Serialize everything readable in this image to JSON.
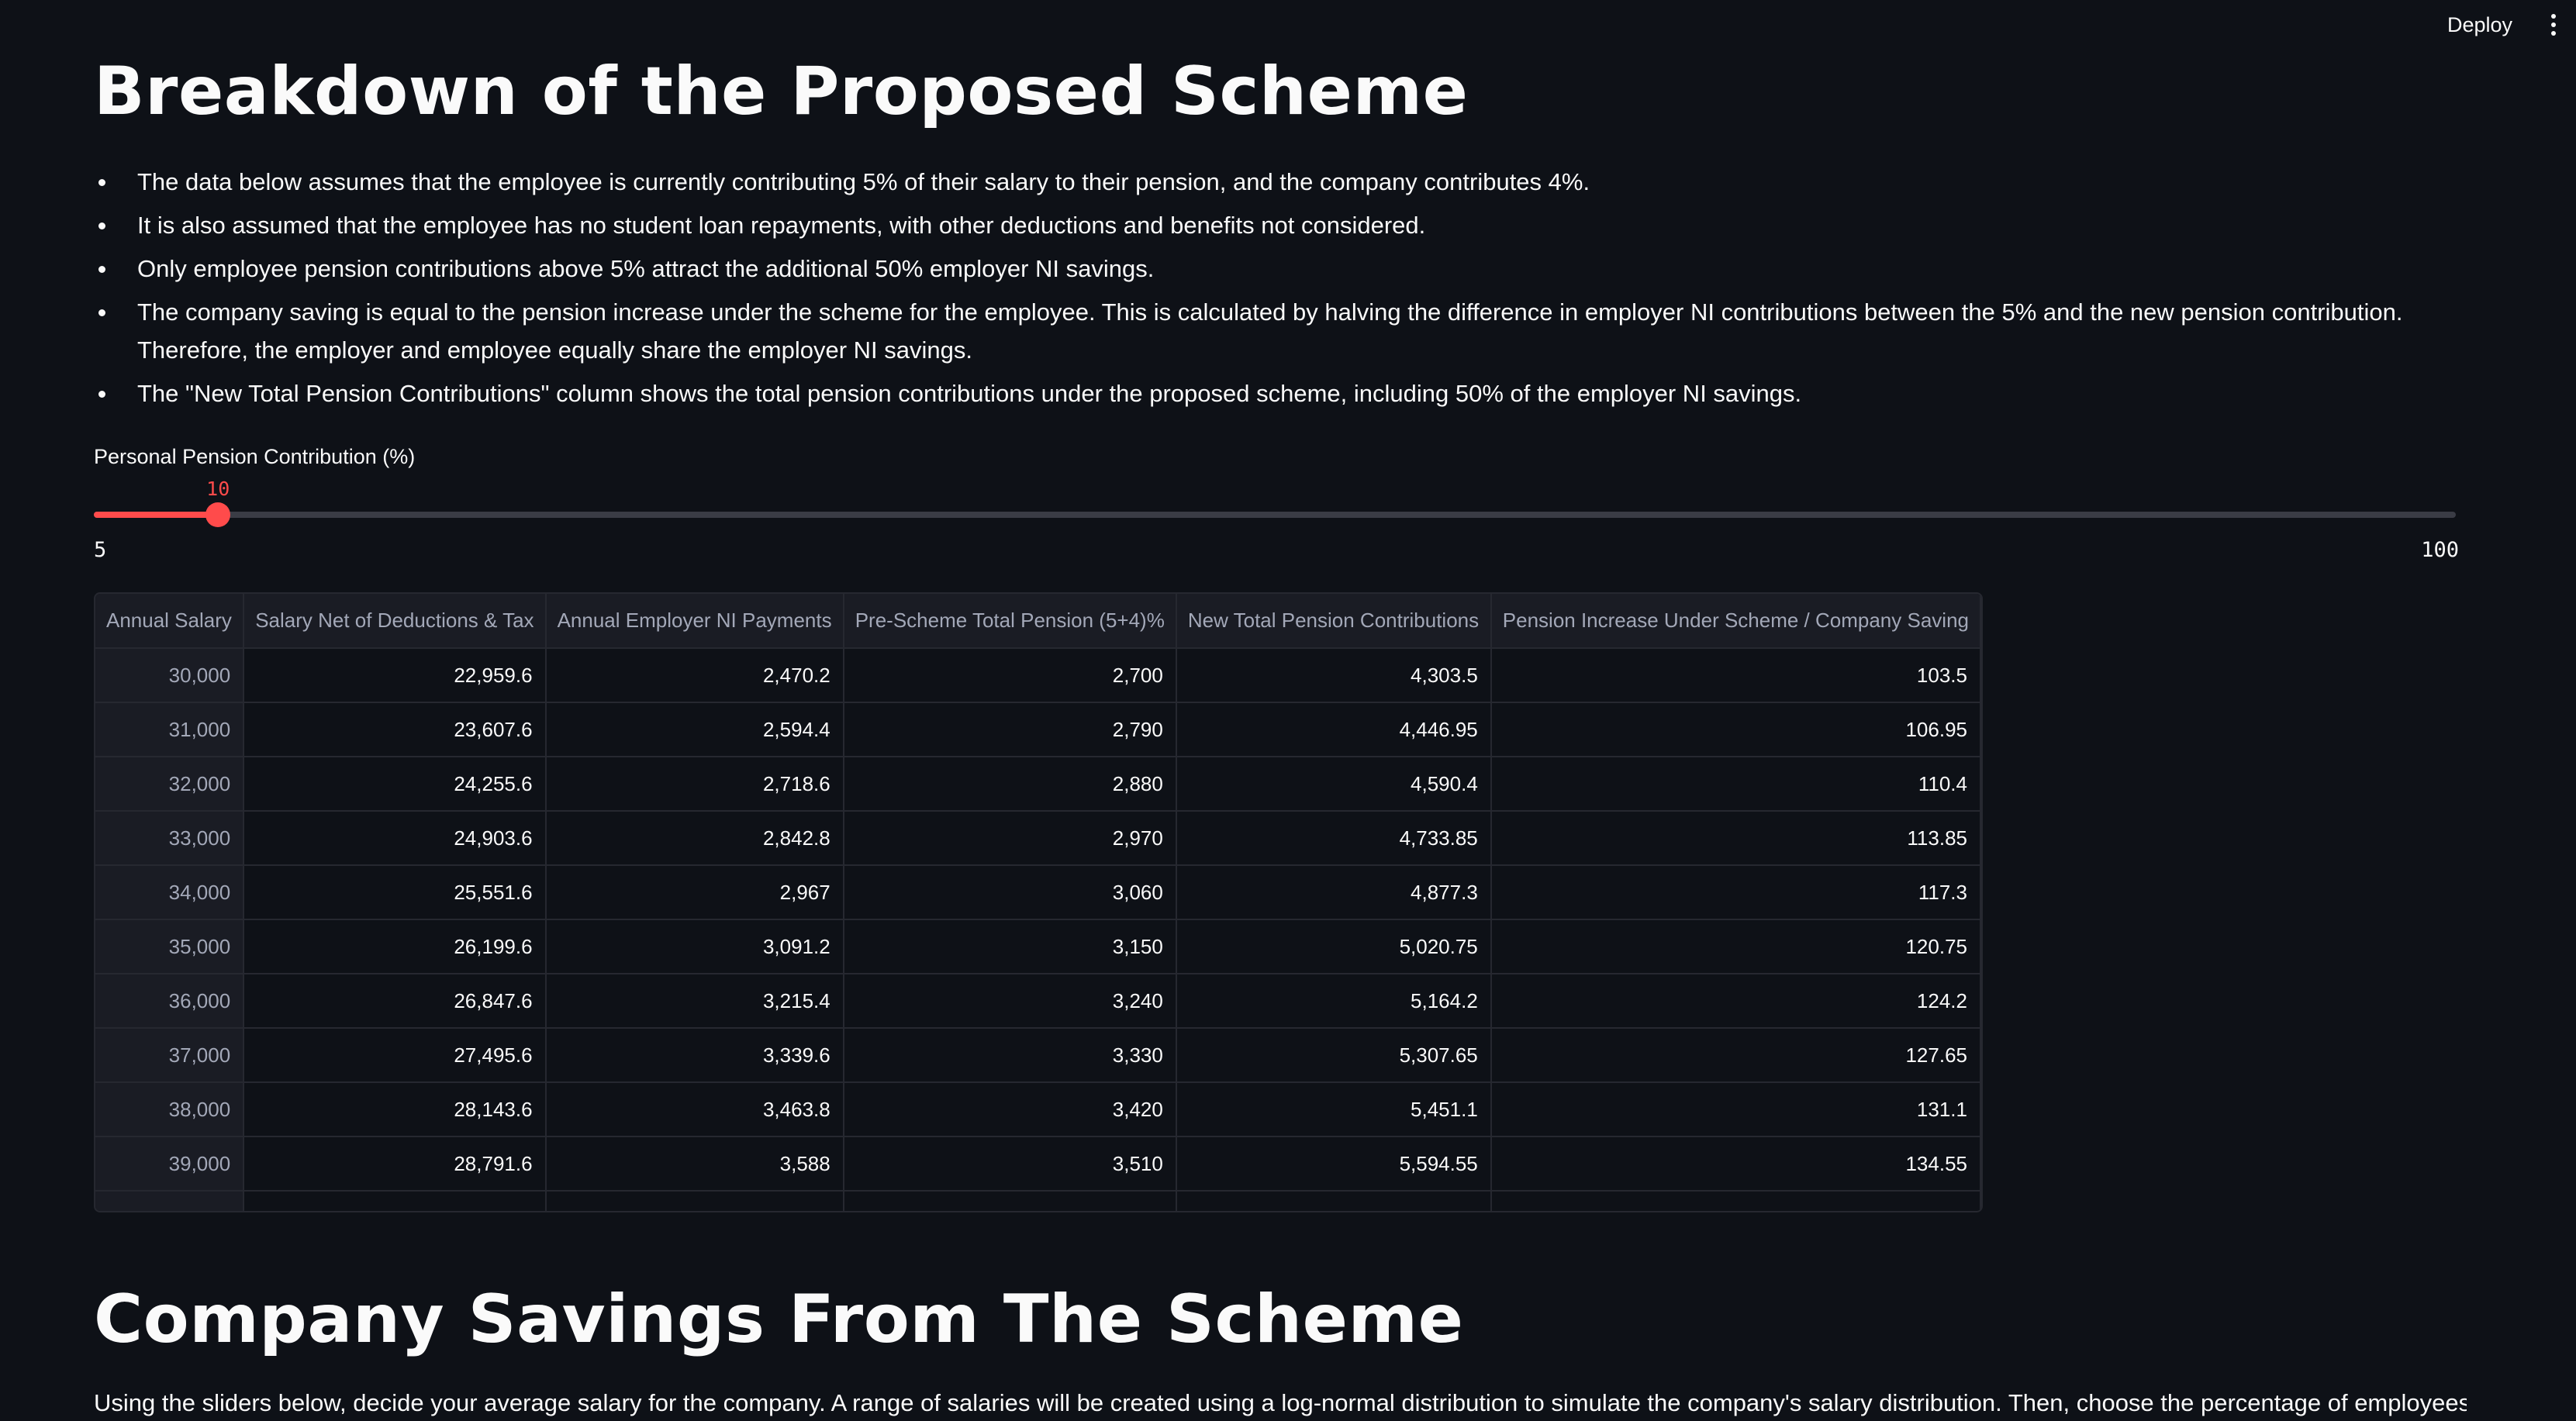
{
  "header": {
    "deploy_label": "Deploy"
  },
  "section1": {
    "title": "Breakdown of the Proposed Scheme",
    "bullets": [
      "The data below assumes that the employee is currently contributing 5% of their salary to their pension, and the company contributes 4%.",
      "It is also assumed that the employee has no student loan repayments, with other deductions and benefits not considered.",
      "Only employee pension contributions above 5% attract the additional 50% employer NI savings.",
      "The company saving is equal to the pension increase under the scheme for the employee. This is calculated by halving the difference in employer NI contributions between the 5% and the new pension contribution. Therefore, the employer and employee equally share the employer NI savings.",
      "The \"New Total Pension Contributions\" column shows the total pension contributions under the proposed scheme, including 50% of the employer NI savings."
    ]
  },
  "slider": {
    "label": "Personal Pension Contribution (%)",
    "value": "10",
    "min": "5",
    "max": "100",
    "level": 0.0526
  },
  "table": {
    "columns": [
      "Annual Salary",
      "Salary Net of Deductions & Tax",
      "Annual Employer NI Payments",
      "Pre-Scheme Total Pension (5+4)%",
      "New Total Pension Contributions",
      "Pension Increase Under Scheme / Company Saving"
    ],
    "rows": [
      [
        "30,000",
        "22,959.6",
        "2,470.2",
        "2,700",
        "4,303.5",
        "103.5"
      ],
      [
        "31,000",
        "23,607.6",
        "2,594.4",
        "2,790",
        "4,446.95",
        "106.95"
      ],
      [
        "32,000",
        "24,255.6",
        "2,718.6",
        "2,880",
        "4,590.4",
        "110.4"
      ],
      [
        "33,000",
        "24,903.6",
        "2,842.8",
        "2,970",
        "4,733.85",
        "113.85"
      ],
      [
        "34,000",
        "25,551.6",
        "2,967",
        "3,060",
        "4,877.3",
        "117.3"
      ],
      [
        "35,000",
        "26,199.6",
        "3,091.2",
        "3,150",
        "5,020.75",
        "120.75"
      ],
      [
        "36,000",
        "26,847.6",
        "3,215.4",
        "3,240",
        "5,164.2",
        "124.2"
      ],
      [
        "37,000",
        "27,495.6",
        "3,339.6",
        "3,330",
        "5,307.65",
        "127.65"
      ],
      [
        "38,000",
        "28,143.6",
        "3,463.8",
        "3,420",
        "5,451.1",
        "131.1"
      ],
      [
        "39,000",
        "28,791.6",
        "3,588",
        "3,510",
        "5,594.55",
        "134.55"
      ]
    ]
  },
  "section2": {
    "title": "Company Savings From The Scheme",
    "intro": "Using the sliders below, decide your average salary for the company. A range of salaries will be created using a log-normal distribution to simulate the company's salary distribution. Then, choose the percentage of employees you"
  },
  "colors": {
    "background": "#0e1117",
    "accent": "#ff4b4b",
    "text": "#fafafa"
  }
}
